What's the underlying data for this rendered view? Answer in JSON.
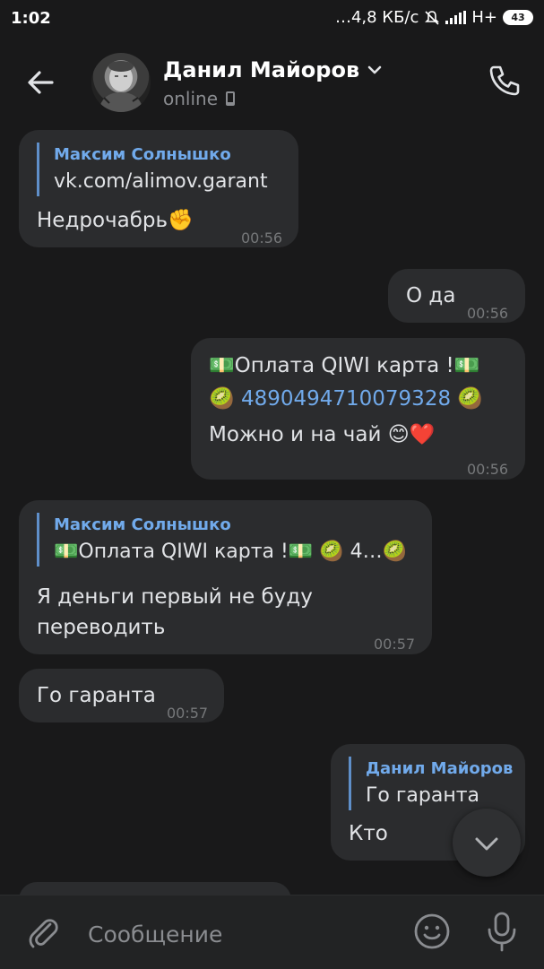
{
  "status_bar": {
    "time": "1:02",
    "network_speed": "…4,8 КБ/с",
    "network_type": "H+",
    "battery": "43"
  },
  "header": {
    "contact_name": "Данил Майоров",
    "status": "online",
    "icons": [
      "back-arrow-icon",
      "chevron-down-icon",
      "phone-icon",
      "mobile-device-icon"
    ]
  },
  "messages": [
    {
      "direction": "in",
      "reply_name": "Максим Солнышко",
      "reply_text": "vk.com/alimov.garant",
      "text": "Недрочабрь✊",
      "time": "00:56"
    },
    {
      "direction": "out",
      "text": "О да",
      "time": "00:56"
    },
    {
      "direction": "out",
      "line1": "💵Оплата QIWI карта !💵",
      "line2_prefix": "🥝 ",
      "line2_link": "4890494710079328",
      "line2_suffix": " 🥝",
      "line3": "Можно и на чай 😊❤️",
      "time": "00:56"
    },
    {
      "direction": "in",
      "reply_name": "Максим Солнышко",
      "reply_text": "💵Оплата QIWI карта !💵 🥝 4…🥝",
      "text_line1": "Я деньги первый не буду",
      "text_line2": "переводить",
      "time": "00:57"
    },
    {
      "direction": "in",
      "text": "Го гаранта",
      "time": "00:57"
    },
    {
      "direction": "out",
      "reply_name": "Данил Майоров",
      "reply_text": "Го гаранта",
      "text": "Кто"
    }
  ],
  "composer": {
    "placeholder": "Сообщение",
    "icons": [
      "paperclip-icon",
      "smile-icon",
      "microphone-icon"
    ]
  },
  "colors": {
    "background": "#19191a",
    "bubble": "#2b2c2e",
    "accent": "#71aaeb"
  }
}
